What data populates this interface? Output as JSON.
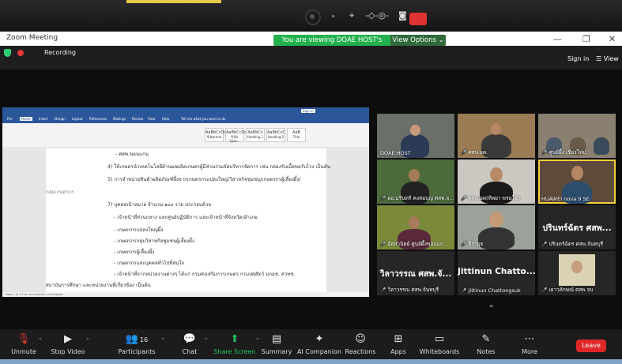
{
  "zoom": {
    "title": "Zoom Meeting",
    "viewing_banner": "You are viewing DOAE HOST's screen",
    "view_options": "View Options",
    "recording": "Recording",
    "sign_in": "Sign in",
    "view": "View",
    "toolbar": {
      "unmute": "Unmute",
      "stop_video": "Stop Video",
      "participants": "Participants",
      "participants_count": "16",
      "chat": "Chat",
      "share_screen": "Share Screen",
      "summary": "Summary",
      "ai_companion": "AI Companion",
      "reactions": "Reactions",
      "apps": "Apps",
      "whiteboards": "Whiteboards",
      "notes": "Notes",
      "more": "More",
      "leave": "Leave"
    },
    "colors": {
      "banner": "#22b14c",
      "leave": "#e02828",
      "active_speaker": "#f4d03f",
      "share_green": "#21c55d"
    }
  },
  "word": {
    "signin": "Sign in",
    "tell_me": "Tell me what you want to do",
    "tabs": [
      "File",
      "Home",
      "Insert",
      "Design",
      "Layout",
      "References",
      "Mailings",
      "Review",
      "View",
      "Help"
    ],
    "styles": [
      {
        "preview": "AaBbCcDc",
        "name": "¶ Normal"
      },
      {
        "preview": "AaBbCcDc",
        "name": "¶ No Spac..."
      },
      {
        "preview": "AaBbCc",
        "name": "Heading 1"
      },
      {
        "preview": "AaBbCcC",
        "name": "Heading 2"
      },
      {
        "preview": "AaB",
        "name": "Title"
      }
    ],
    "doc_lines": [
      "- ศสพ.ขอนแก่น",
      "4) ให้เกษตรนำเทคโนโลยีด้านผลผลิตเกษตรผู้มีส่วนร่วมจัดบริหารจัดการ เช่น กล่องรับเมื้อขอรับไรง เป็นต้น",
      "5) การจำหน่ายสินค้าผลิตภัณฑ์ผึ้งจากเกษตรกรแปลงใหญ่/วิสาหกิจชุมชน/เกษตรกรผู้เลี้ยงผึ้ง/",
      "กลุ่มเกษตรกร",
      "7) บุคคลเป้าหมาย จำนวน ๑๐๐ ราย ประกอบด้วย",
      "- เจ้าหน้าที่ส่วนกลาง และศูนย์ปฏิบัติการ และเจ้าหน้าที่จังหวัด/อำเภอ",
      "- เกษตรกรแปลงใหญ่ผึ้ง",
      "- เกษตรกรกลุ่มวิสาหกิจชุมชนผู้เลี้ยงผึ้ง",
      "- เกษตรกรผู้เลี้ยงผึ้ง",
      "- เกษตรกรและบุคคลทั่วไปที่สนใจ",
      "- เจ้าหน้าที่จากหน่วยงานต่างๆ ได้แก่ กรมส่งเสริมการเกษตร กรมปศุสัตว์ มกอช. สวทช.",
      "สถาบันการศึกษา และหน่วยงานที่เกี่ยวข้อง เป็นต้น"
    ],
    "status": "Page 1 of 4   Thai   Accessibility: Investigate"
  },
  "gallery": {
    "tiles": [
      {
        "name": "DOAE HOST",
        "muted": false,
        "video": true
      },
      {
        "name": "ศสพ.อด.",
        "muted": true,
        "video": true
      },
      {
        "name": "ศูนย์ผึ้ง เชียงใหม่",
        "muted": true,
        "video": true
      },
      {
        "name": "ผอ.นรินทร์ คงสมบุญ ศสพ.จ...",
        "muted": true,
        "video": true
      },
      {
        "name": "ศสพ.อด(ทิพยา พรมโต)",
        "muted": true,
        "video": true
      },
      {
        "name": "HUAWEI nova 9 SE",
        "muted": true,
        "video": true,
        "active": true
      },
      {
        "name": "อัสสวนิตย์ ศูนย์ผึ้งขอนแก่...",
        "muted": true,
        "video": true
      },
      {
        "name": "ธีรายุธ",
        "muted": true,
        "video": true
      },
      {
        "name": "ปรินทร์ฉัตร ศสพ.จันทบุรี",
        "big": "ปรินทร์ฉัตร ศสพ...",
        "muted": true,
        "video": false
      },
      {
        "name": "วิลาวรรณ ศสพ.จันทบุรี",
        "big": "วิลาวรรณ ศสพ.จั...",
        "muted": true,
        "video": false
      },
      {
        "name": "Jittinun Chattongsuk",
        "big": "Jittinun Chatto...",
        "muted": true,
        "video": false
      },
      {
        "name": "เยาวลักษณ์ ศสพ จบ",
        "muted": true,
        "video": true
      }
    ]
  }
}
